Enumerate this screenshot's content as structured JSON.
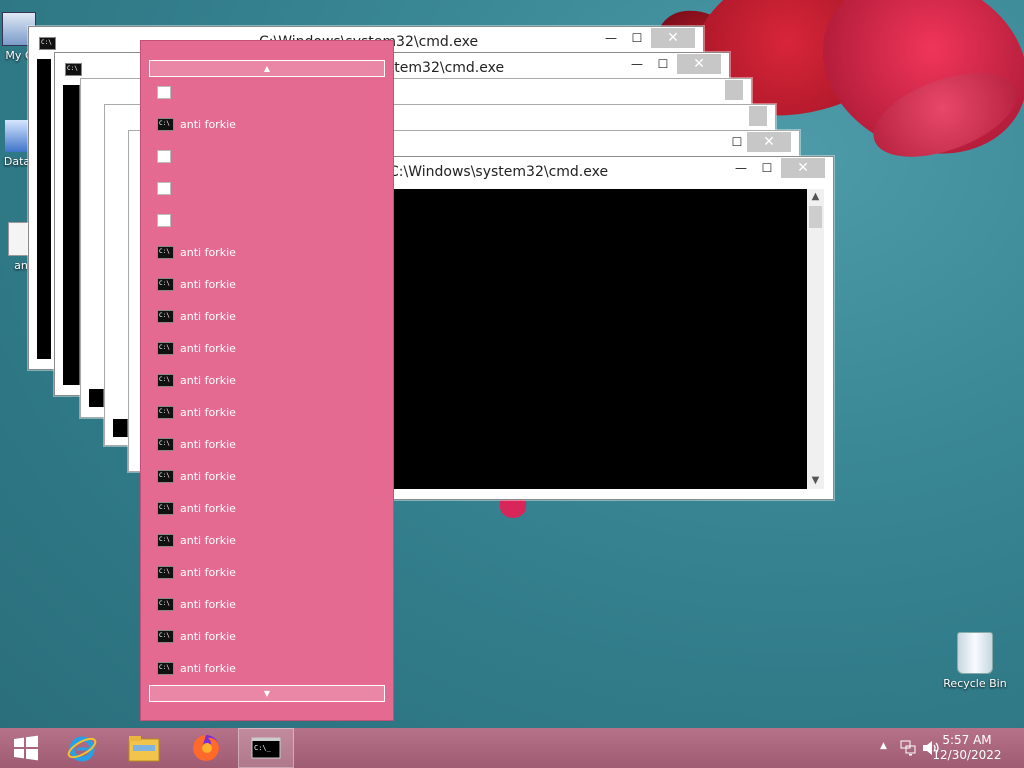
{
  "desktop": {
    "icons": [
      {
        "label": "My C"
      },
      {
        "label": "Data"
      },
      {
        "label": "an"
      },
      {
        "label": "Recycle Bin"
      }
    ]
  },
  "windows": [
    {
      "title": "C:\\Windows\\system32\\cmd.exe"
    },
    {
      "title": "C:\\Windows\\system32\\cmd.exe"
    },
    {
      "title": "C:\\Windows\\system32\\cmd.exe"
    }
  ],
  "window_controls": {
    "minimize": "—",
    "maximize": "☐",
    "close": "✕"
  },
  "jump_menu": {
    "scroll_up": "▲",
    "scroll_down": "▼",
    "items": [
      {
        "label": ""
      },
      {
        "label": "anti forkie"
      },
      {
        "label": ""
      },
      {
        "label": ""
      },
      {
        "label": ""
      },
      {
        "label": "anti forkie"
      },
      {
        "label": "anti forkie"
      },
      {
        "label": "anti forkie"
      },
      {
        "label": "anti forkie"
      },
      {
        "label": "anti forkie"
      },
      {
        "label": "anti forkie"
      },
      {
        "label": "anti forkie"
      },
      {
        "label": "anti forkie"
      },
      {
        "label": "anti forkie"
      },
      {
        "label": "anti forkie"
      },
      {
        "label": "anti forkie"
      },
      {
        "label": "anti forkie"
      },
      {
        "label": "anti forkie"
      },
      {
        "label": "anti forkie"
      }
    ]
  },
  "taskbar": {
    "apps": [
      "start-icon",
      "internet-explorer-icon",
      "file-explorer-icon",
      "firefox-icon",
      "cmd-icon"
    ],
    "tray_arrow": "▲",
    "time": "5:57 AM",
    "date": "12/30/2022"
  },
  "colors": {
    "menu_bg": "#e56a92",
    "taskbar": "#a9647b",
    "desktop": "#3a8795"
  }
}
